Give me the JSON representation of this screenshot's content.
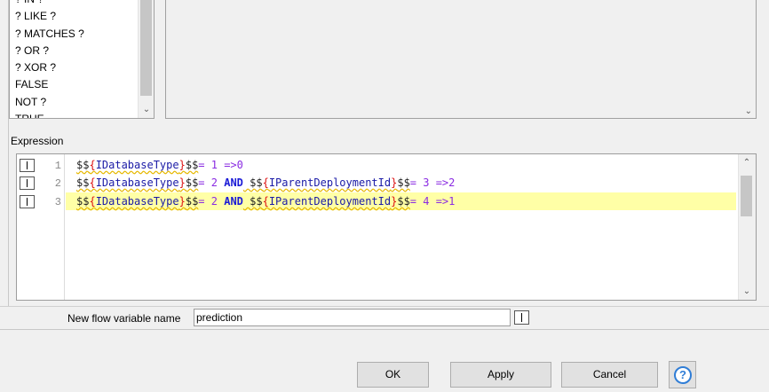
{
  "functions": {
    "items": [
      "? IN ?",
      "? LIKE ?",
      "? MATCHES ?",
      "? OR ?",
      "? XOR ?",
      "FALSE",
      "NOT ?",
      "TRUE"
    ]
  },
  "expression": {
    "label": "Expression",
    "line_numbers": [
      "1",
      "2",
      "3"
    ],
    "active_line": 3,
    "lines": [
      [
        {
          "t": "p",
          "v": "$$"
        },
        {
          "t": "b",
          "v": "{"
        },
        {
          "t": "v",
          "v": "IDatabaseType"
        },
        {
          "t": "b",
          "v": "}"
        },
        {
          "t": "p",
          "v": "$$"
        },
        {
          "t": "o",
          "v": "= "
        },
        {
          "t": "n",
          "v": "1"
        },
        {
          "t": "o",
          "v": " =>"
        },
        {
          "t": "n",
          "v": "0"
        }
      ],
      [
        {
          "t": "p",
          "v": "$$"
        },
        {
          "t": "b",
          "v": "{"
        },
        {
          "t": "v",
          "v": "IDatabaseType"
        },
        {
          "t": "b",
          "v": "}"
        },
        {
          "t": "p",
          "v": "$$"
        },
        {
          "t": "o",
          "v": "= "
        },
        {
          "t": "n",
          "v": "2"
        },
        {
          "t": "p",
          "v": " "
        },
        {
          "t": "k",
          "v": "AND"
        },
        {
          "t": "p",
          "v": " $$"
        },
        {
          "t": "b",
          "v": "{"
        },
        {
          "t": "v",
          "v": "IParentDeploymentId"
        },
        {
          "t": "b",
          "v": "}"
        },
        {
          "t": "p",
          "v": "$$"
        },
        {
          "t": "o",
          "v": "= "
        },
        {
          "t": "n",
          "v": "3"
        },
        {
          "t": "o",
          "v": " =>"
        },
        {
          "t": "n",
          "v": "2"
        }
      ],
      [
        {
          "t": "p",
          "v": "$$"
        },
        {
          "t": "b",
          "v": "{"
        },
        {
          "t": "v",
          "v": "IDatabaseType"
        },
        {
          "t": "b",
          "v": "}"
        },
        {
          "t": "p",
          "v": "$$"
        },
        {
          "t": "o",
          "v": "= "
        },
        {
          "t": "n",
          "v": "2"
        },
        {
          "t": "p",
          "v": " "
        },
        {
          "t": "k",
          "v": "AND"
        },
        {
          "t": "p",
          "v": " $$"
        },
        {
          "t": "b",
          "v": "{"
        },
        {
          "t": "v",
          "v": "IParentDeploymentId"
        },
        {
          "t": "b",
          "v": "}"
        },
        {
          "t": "p",
          "v": "$$"
        },
        {
          "t": "o",
          "v": "= "
        },
        {
          "t": "n",
          "v": "4"
        },
        {
          "t": "o",
          "v": " =>"
        },
        {
          "t": "n",
          "v": "1"
        }
      ]
    ]
  },
  "flow_variable": {
    "label": "New flow variable name",
    "value": "prediction"
  },
  "buttons": {
    "ok": "OK",
    "apply": "Apply",
    "cancel": "Cancel",
    "help": "?"
  },
  "colors": {
    "active_line": "#ffffa6",
    "keyword": "#1a1ad6",
    "help_accent": "#2f7dd6"
  },
  "icons": {
    "scroll_up": "chevron-up-icon",
    "scroll_down": "chevron-down-icon",
    "help": "help-icon"
  }
}
